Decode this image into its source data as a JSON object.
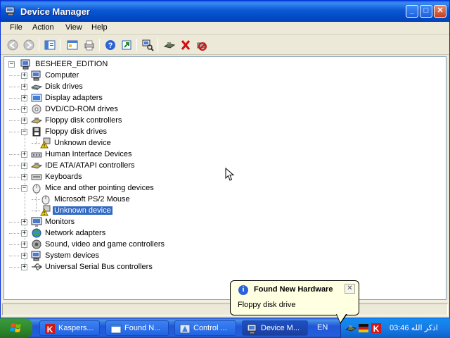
{
  "window": {
    "title": "Device Manager",
    "minimize": "_",
    "maximize": "□",
    "close": "✕"
  },
  "menu": [
    "File",
    "Action",
    "View",
    "Help"
  ],
  "toolbar_icons": [
    "back-icon",
    "forward-icon",
    "up-folder-icon",
    "properties-icon",
    "print-icon",
    "help-icon",
    "export-icon",
    "scan-hardware-icon",
    "update-driver-icon",
    "uninstall-icon",
    "disable-icon"
  ],
  "tree": {
    "root": "BESHEER_EDITION",
    "nodes": [
      {
        "label": "Computer",
        "icon": "computer-icon",
        "state": "+"
      },
      {
        "label": "Disk drives",
        "icon": "disk-drive-icon",
        "state": "+"
      },
      {
        "label": "Display adapters",
        "icon": "display-adapter-icon",
        "state": "+"
      },
      {
        "label": "DVD/CD-ROM drives",
        "icon": "cdrom-icon",
        "state": "+"
      },
      {
        "label": "Floppy disk controllers",
        "icon": "floppy-controller-icon",
        "state": "+"
      },
      {
        "label": "Floppy disk drives",
        "icon": "floppy-drive-icon",
        "state": "−"
      },
      {
        "label": "Unknown device",
        "icon": "warning-device-icon",
        "child": true
      },
      {
        "label": "Human Interface Devices",
        "icon": "hid-icon",
        "state": "+"
      },
      {
        "label": "IDE ATA/ATAPI controllers",
        "icon": "ide-controller-icon",
        "state": "+"
      },
      {
        "label": "Keyboards",
        "icon": "keyboard-icon",
        "state": "+"
      },
      {
        "label": "Mice and other pointing devices",
        "icon": "mouse-icon",
        "state": "−"
      },
      {
        "label": "Microsoft PS/2 Mouse",
        "icon": "mouse-icon",
        "child": true
      },
      {
        "label": "Unknown device",
        "icon": "warning-device-icon",
        "child": true,
        "selected": true
      },
      {
        "label": "Monitors",
        "icon": "monitor-icon",
        "state": "+"
      },
      {
        "label": "Network adapters",
        "icon": "network-adapter-icon",
        "state": "+"
      },
      {
        "label": "Sound, video and game controllers",
        "icon": "sound-icon",
        "state": "+"
      },
      {
        "label": "System devices",
        "icon": "system-device-icon",
        "state": "+"
      },
      {
        "label": "Universal Serial Bus controllers",
        "icon": "usb-icon",
        "state": "+"
      }
    ]
  },
  "balloon": {
    "title": "Found New Hardware",
    "text": "Floppy disk drive",
    "close": "✕"
  },
  "taskbar": {
    "tasks": [
      {
        "label": "Kaspers...",
        "icon": "kaspersky-icon"
      },
      {
        "label": "Found N...",
        "icon": "window-icon"
      },
      {
        "label": "Control ...",
        "icon": "control-panel-icon"
      },
      {
        "label": "Device M...",
        "icon": "device-manager-icon",
        "active": true
      }
    ],
    "language": "EN",
    "clock": "03:46 اذكر الله"
  },
  "colors": {
    "titlebar": "#0a58d4",
    "selection": "#316ac5",
    "taskbar": "#245edb",
    "start": "#2f8a2f"
  }
}
